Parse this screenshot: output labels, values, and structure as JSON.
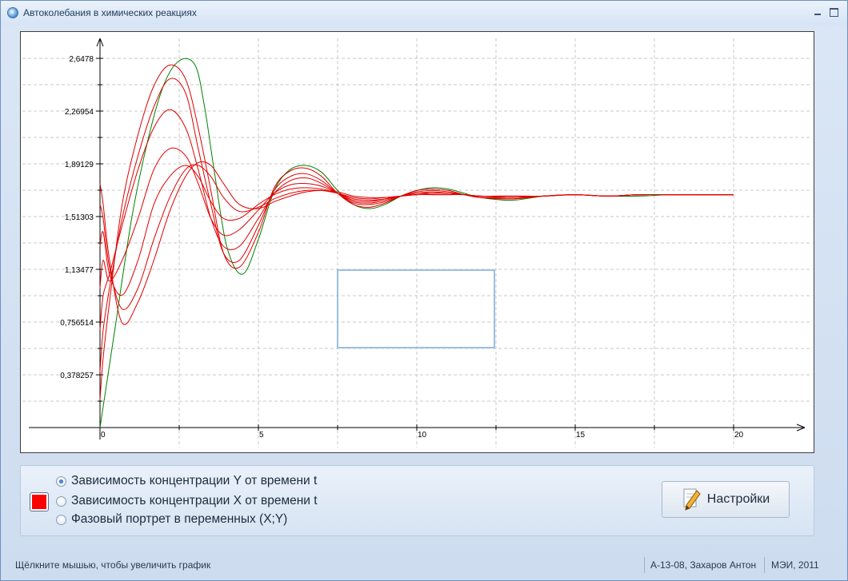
{
  "window": {
    "title": "Автоколебания в химических реакциях"
  },
  "chart_data": {
    "type": "line",
    "x_ticks": [
      "0",
      "5",
      "10",
      "15",
      "20"
    ],
    "y_ticks": [
      "0,378257",
      "0,756514",
      "1,13477",
      "1,51303",
      "1,89129",
      "2,26954",
      "2,6478"
    ],
    "xlim": [
      0,
      20
    ],
    "ylim": [
      0,
      2.6478
    ],
    "grid": true,
    "series": [
      {
        "color": "#008000",
        "x": [
          0,
          0.2,
          0.5,
          1,
          1.5,
          2,
          2.5,
          3,
          3.3,
          3.6,
          4,
          4.5,
          5,
          5.5,
          6,
          6.5,
          7,
          7.5,
          8,
          8.5,
          9,
          9.5,
          10,
          10.5,
          11,
          11.5,
          12,
          13,
          14,
          15,
          16,
          17,
          18,
          19,
          20
        ],
        "y": [
          0,
          0.3,
          0.75,
          1.5,
          2.05,
          2.45,
          2.63,
          2.6,
          2.3,
          1.85,
          1.3,
          1.1,
          1.35,
          1.7,
          1.85,
          1.88,
          1.83,
          1.7,
          1.6,
          1.57,
          1.6,
          1.66,
          1.7,
          1.72,
          1.71,
          1.68,
          1.65,
          1.63,
          1.66,
          1.67,
          1.66,
          1.66,
          1.67,
          1.67,
          1.67
        ]
      },
      {
        "color": "#e00000",
        "x": [
          0,
          0.1,
          0.3,
          0.7,
          1.2,
          1.7,
          2.2,
          2.7,
          3.1,
          3.5,
          3.9,
          4.4,
          5,
          5.5,
          6,
          6.5,
          7,
          7.5,
          8,
          8.5,
          9,
          9.5,
          10,
          10.5,
          11,
          11.5,
          12,
          13,
          14,
          15,
          16,
          17,
          18,
          19,
          20
        ],
        "y": [
          0.2,
          0.5,
          0.9,
          1.6,
          2.1,
          2.45,
          2.6,
          2.5,
          2.15,
          1.7,
          1.25,
          1.15,
          1.4,
          1.72,
          1.84,
          1.86,
          1.8,
          1.68,
          1.6,
          1.58,
          1.61,
          1.66,
          1.7,
          1.71,
          1.7,
          1.67,
          1.65,
          1.64,
          1.66,
          1.67,
          1.66,
          1.67,
          1.67,
          1.67,
          1.67
        ]
      },
      {
        "color": "#e00000",
        "x": [
          0,
          0.1,
          0.3,
          0.7,
          1.2,
          1.7,
          2.2,
          2.7,
          3.1,
          3.5,
          3.9,
          4.4,
          5,
          5.5,
          6,
          6.5,
          7,
          7.5,
          8,
          8.5,
          9,
          9.5,
          10,
          10.5,
          11,
          11.5,
          12,
          13,
          14,
          15,
          16,
          17,
          18,
          19,
          20
        ],
        "y": [
          0.4,
          0.7,
          1.0,
          1.5,
          1.95,
          2.3,
          2.5,
          2.4,
          2.0,
          1.6,
          1.25,
          1.2,
          1.45,
          1.7,
          1.8,
          1.82,
          1.77,
          1.68,
          1.61,
          1.6,
          1.62,
          1.66,
          1.69,
          1.7,
          1.69,
          1.67,
          1.65,
          1.64,
          1.66,
          1.67,
          1.66,
          1.67,
          1.67,
          1.67,
          1.67
        ]
      },
      {
        "color": "#e00000",
        "x": [
          0,
          0.1,
          0.3,
          0.7,
          1.2,
          1.7,
          2.2,
          2.7,
          3.1,
          3.5,
          3.9,
          4.4,
          5,
          5.5,
          6,
          6.5,
          7,
          7.5,
          8,
          8.5,
          9,
          9.5,
          10,
          10.5,
          11,
          11.5,
          12,
          13,
          14,
          15,
          16,
          17,
          18,
          19,
          20
        ],
        "y": [
          0.7,
          0.95,
          1.1,
          1.45,
          1.85,
          2.15,
          2.28,
          2.15,
          1.85,
          1.5,
          1.3,
          1.3,
          1.5,
          1.68,
          1.77,
          1.79,
          1.75,
          1.68,
          1.62,
          1.61,
          1.63,
          1.66,
          1.68,
          1.69,
          1.68,
          1.67,
          1.65,
          1.65,
          1.66,
          1.67,
          1.66,
          1.67,
          1.67,
          1.67,
          1.67
        ]
      },
      {
        "color": "#e00000",
        "x": [
          0,
          0.1,
          0.3,
          0.7,
          1.2,
          1.7,
          2.2,
          2.7,
          3.1,
          3.5,
          3.9,
          4.4,
          5,
          5.5,
          6,
          6.5,
          7,
          7.5,
          8,
          8.5,
          9,
          9.5,
          10,
          10.5,
          11,
          11.5,
          12,
          13,
          14,
          15,
          16,
          17,
          18,
          19,
          20
        ],
        "y": [
          1.0,
          1.2,
          1.05,
          1.2,
          1.5,
          1.85,
          2.0,
          1.95,
          1.75,
          1.5,
          1.38,
          1.42,
          1.56,
          1.68,
          1.74,
          1.75,
          1.73,
          1.68,
          1.63,
          1.62,
          1.64,
          1.66,
          1.68,
          1.68,
          1.68,
          1.67,
          1.66,
          1.65,
          1.66,
          1.67,
          1.66,
          1.67,
          1.67,
          1.67,
          1.67
        ]
      },
      {
        "color": "#e00000",
        "x": [
          0,
          0.1,
          0.3,
          0.7,
          1.2,
          1.7,
          2.2,
          2.7,
          3.1,
          3.5,
          3.9,
          4.4,
          5,
          5.5,
          6,
          6.5,
          7,
          7.5,
          8,
          8.5,
          9,
          9.5,
          10,
          10.5,
          11,
          11.5,
          12,
          13,
          14,
          15,
          16,
          17,
          18,
          19,
          20
        ],
        "y": [
          1.3,
          1.4,
          1.1,
          0.95,
          1.2,
          1.6,
          1.8,
          1.88,
          1.8,
          1.62,
          1.5,
          1.5,
          1.6,
          1.67,
          1.71,
          1.72,
          1.71,
          1.68,
          1.64,
          1.63,
          1.64,
          1.66,
          1.67,
          1.68,
          1.68,
          1.67,
          1.66,
          1.65,
          1.66,
          1.67,
          1.66,
          1.67,
          1.67,
          1.67,
          1.67
        ]
      },
      {
        "color": "#e00000",
        "x": [
          0,
          0.1,
          0.3,
          0.7,
          1.2,
          1.7,
          2.2,
          2.7,
          3.1,
          3.5,
          3.9,
          4.4,
          5,
          5.5,
          6,
          6.5,
          7,
          7.5,
          8,
          8.5,
          9,
          9.5,
          10,
          10.5,
          11,
          11.5,
          12,
          13,
          14,
          15,
          16,
          17,
          18,
          19,
          20
        ],
        "y": [
          1.6,
          1.5,
          1.15,
          0.85,
          1.0,
          1.35,
          1.65,
          1.85,
          1.88,
          1.8,
          1.65,
          1.55,
          1.58,
          1.64,
          1.68,
          1.7,
          1.7,
          1.68,
          1.65,
          1.64,
          1.65,
          1.66,
          1.67,
          1.67,
          1.67,
          1.67,
          1.66,
          1.66,
          1.66,
          1.67,
          1.66,
          1.67,
          1.67,
          1.67,
          1.67
        ]
      },
      {
        "color": "#e00000",
        "x": [
          0,
          0.1,
          0.3,
          0.7,
          1.2,
          1.7,
          2.2,
          2.7,
          3.1,
          3.5,
          3.9,
          4.4,
          5,
          5.5,
          6,
          6.5,
          7,
          7.5,
          8,
          8.5,
          9,
          9.5,
          10,
          10.5,
          11,
          11.5,
          12,
          13,
          14,
          15,
          16,
          17,
          18,
          19,
          20
        ],
        "y": [
          1.75,
          1.6,
          1.2,
          0.75,
          0.9,
          1.2,
          1.55,
          1.8,
          1.9,
          1.88,
          1.75,
          1.6,
          1.57,
          1.62,
          1.66,
          1.69,
          1.7,
          1.69,
          1.66,
          1.65,
          1.65,
          1.66,
          1.67,
          1.67,
          1.67,
          1.67,
          1.66,
          1.66,
          1.66,
          1.67,
          1.66,
          1.67,
          1.67,
          1.67,
          1.67
        ]
      }
    ]
  },
  "options": {
    "swatch_color": "#ff0000",
    "radios": [
      {
        "label": "Зависимость концентрации Y от времени t",
        "checked": true
      },
      {
        "label": "Зависимость концентрации X от времени t",
        "checked": false
      },
      {
        "label": "Фазовый портрет в переменных (X;Y)",
        "checked": false
      }
    ],
    "settings_label": "Настройки"
  },
  "status": {
    "hint": "Щёлкните мышью, чтобы увеличить график",
    "author": "А-13-08, Захаров Антон",
    "org": "МЭИ, 2011"
  }
}
